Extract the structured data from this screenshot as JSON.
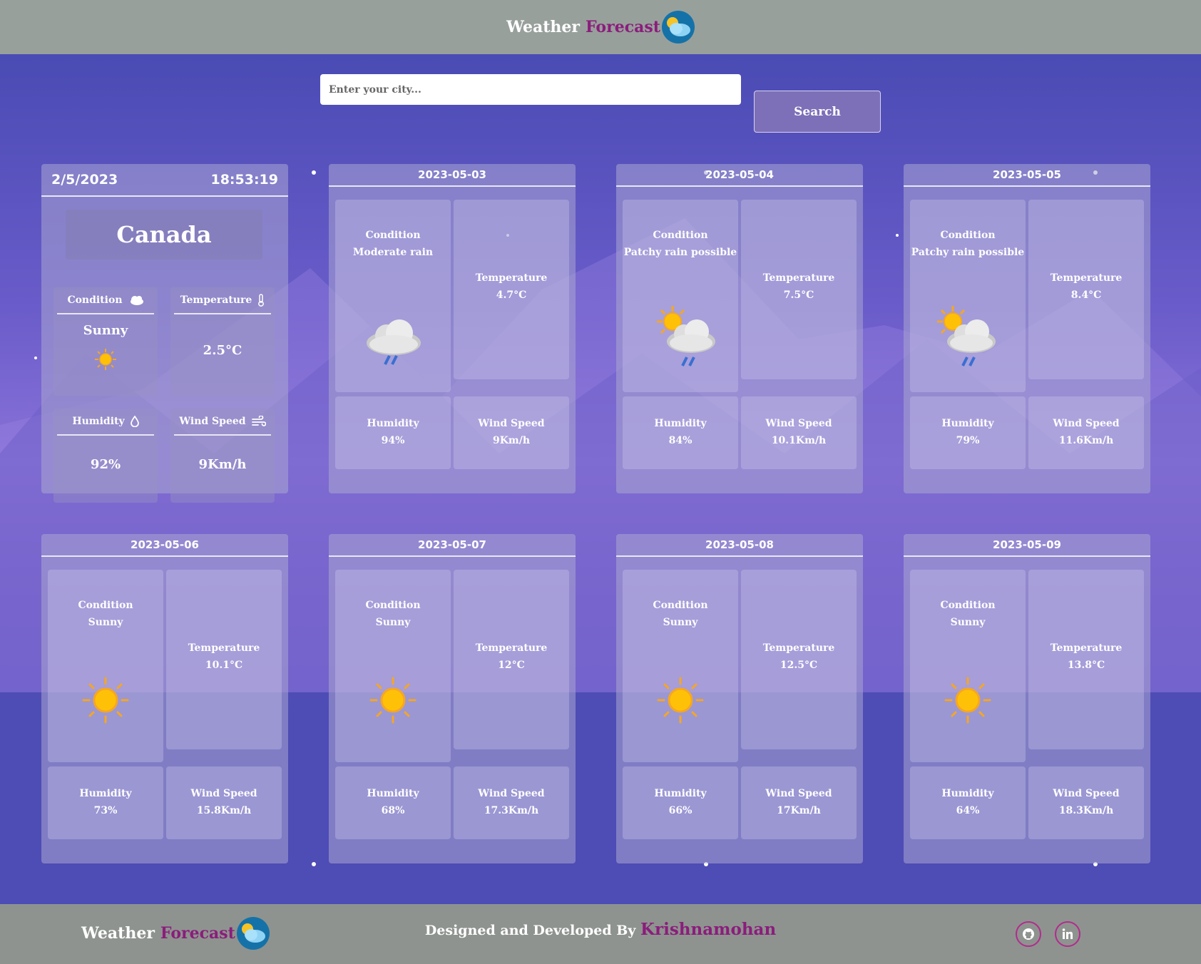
{
  "header": {
    "brand_part1": "Weather",
    "brand_part2": "Forecast"
  },
  "search": {
    "placeholder": "Enter your city...",
    "button_label": "Search"
  },
  "current": {
    "date": "2/5/2023",
    "time": "18:53:19",
    "city": "Canada",
    "condition_label": "Condition",
    "condition_value": "Sunny",
    "temperature_label": "Temperature",
    "temperature_value": "2.5°C",
    "humidity_label": "Humidity",
    "humidity_value": "92%",
    "wind_label": "Wind Speed",
    "wind_value": "9Km/h"
  },
  "labels": {
    "condition": "Condition",
    "temperature": "Temperature",
    "humidity": "Humidity",
    "wind": "Wind Speed"
  },
  "forecast": [
    {
      "date": "2023-05-03",
      "condition": "Moderate rain",
      "temperature": "4.7°C",
      "humidity": "94%",
      "wind": "9Km/h",
      "icon": "rain-cloud-icon"
    },
    {
      "date": "2023-05-04",
      "condition": "Patchy rain possible",
      "temperature": "7.5°C",
      "humidity": "84%",
      "wind": "10.1Km/h",
      "icon": "sun-cloud-rain-icon"
    },
    {
      "date": "2023-05-05",
      "condition": "Patchy rain possible",
      "temperature": "8.4°C",
      "humidity": "79%",
      "wind": "11.6Km/h",
      "icon": "sun-cloud-rain-icon"
    },
    {
      "date": "2023-05-06",
      "condition": "Sunny",
      "temperature": "10.1°C",
      "humidity": "73%",
      "wind": "15.8Km/h",
      "icon": "sun-icon"
    },
    {
      "date": "2023-05-07",
      "condition": "Sunny",
      "temperature": "12°C",
      "humidity": "68%",
      "wind": "17.3Km/h",
      "icon": "sun-icon"
    },
    {
      "date": "2023-05-08",
      "condition": "Sunny",
      "temperature": "12.5°C",
      "humidity": "66%",
      "wind": "17Km/h",
      "icon": "sun-icon"
    },
    {
      "date": "2023-05-09",
      "condition": "Sunny",
      "temperature": "13.8°C",
      "humidity": "64%",
      "wind": "18.3Km/h",
      "icon": "sun-icon"
    }
  ],
  "footer": {
    "brand_part1": "Weather",
    "brand_part2": "Forecast",
    "credit_prefix": "Designed and Developed By",
    "credit_name": "Krishnamohan",
    "social": [
      "github-icon",
      "linkedin-icon"
    ]
  },
  "colors": {
    "header_bg": "#98a09c",
    "footer_bg": "#8e938f",
    "accent": "#8b1d7c"
  }
}
